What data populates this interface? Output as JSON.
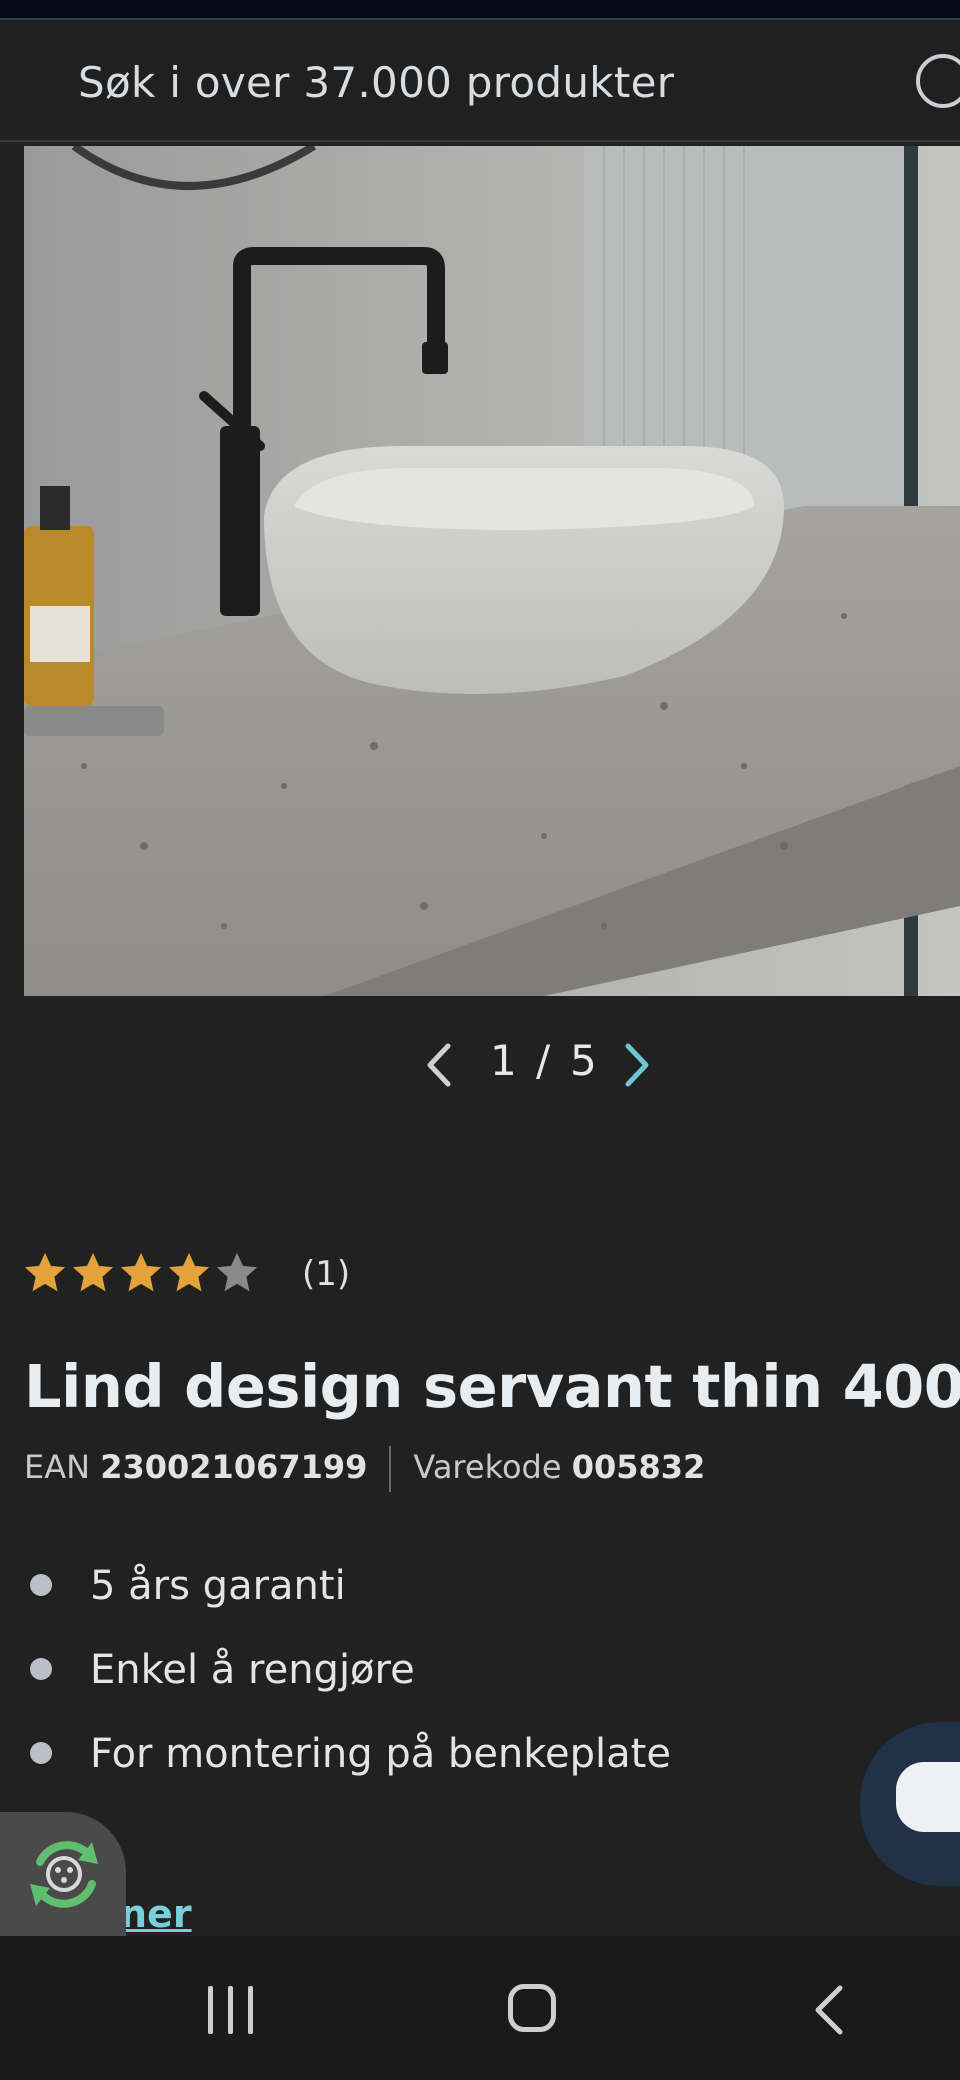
{
  "search": {
    "placeholder": "Søk i over 37.000 produkter"
  },
  "gallery": {
    "current": "1",
    "separator": "/",
    "total": "5"
  },
  "rating": {
    "stars": 4,
    "max": 5,
    "count_label": "(1)"
  },
  "product": {
    "title": "Lind design servant thin 400",
    "ean_label": "EAN",
    "ean_value": "230021067199",
    "code_label": "Varekode",
    "code_value": "005832",
    "features": [
      "5 års garanti",
      "Enkel å rengjøre",
      "For montering på benkeplate"
    ]
  },
  "links": {
    "more": "ner"
  },
  "colors": {
    "accent": "#7ad0d8",
    "star": "#e6a23a",
    "background": "#212121"
  }
}
